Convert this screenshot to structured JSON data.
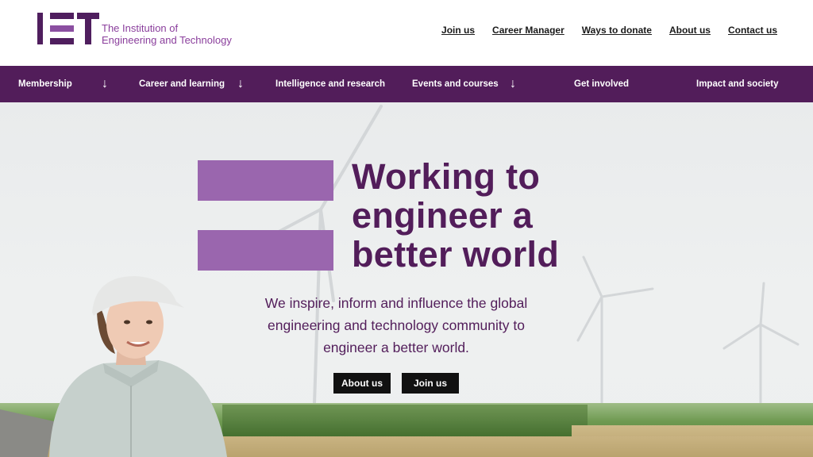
{
  "logo": {
    "line1": "The Institution of",
    "line2": "Engineering and Technology",
    "brand_color": "#521d5a",
    "accent_color": "#9a66ae"
  },
  "top_links": [
    "Join us",
    "Career Manager",
    "Ways to donate",
    "About us",
    "Contact us"
  ],
  "nav": {
    "items": [
      {
        "label": "Membership",
        "has_dropdown": true
      },
      {
        "label": "Career and learning",
        "has_dropdown": true
      },
      {
        "label": "Intelligence and research",
        "has_dropdown": false
      },
      {
        "label": "Events and courses",
        "has_dropdown": true
      },
      {
        "label": "Get involved",
        "has_dropdown": false
      },
      {
        "label": "Impact and society",
        "has_dropdown": false
      }
    ],
    "arrow_glyph": "↓"
  },
  "hero": {
    "title_lines": [
      "Working to",
      "engineer a",
      "better world"
    ],
    "subtitle_lines": [
      "We inspire, inform and influence the global",
      "engineering and technology community to",
      "engineer a better world."
    ],
    "about_button": "About us",
    "join_button": "Join us"
  }
}
